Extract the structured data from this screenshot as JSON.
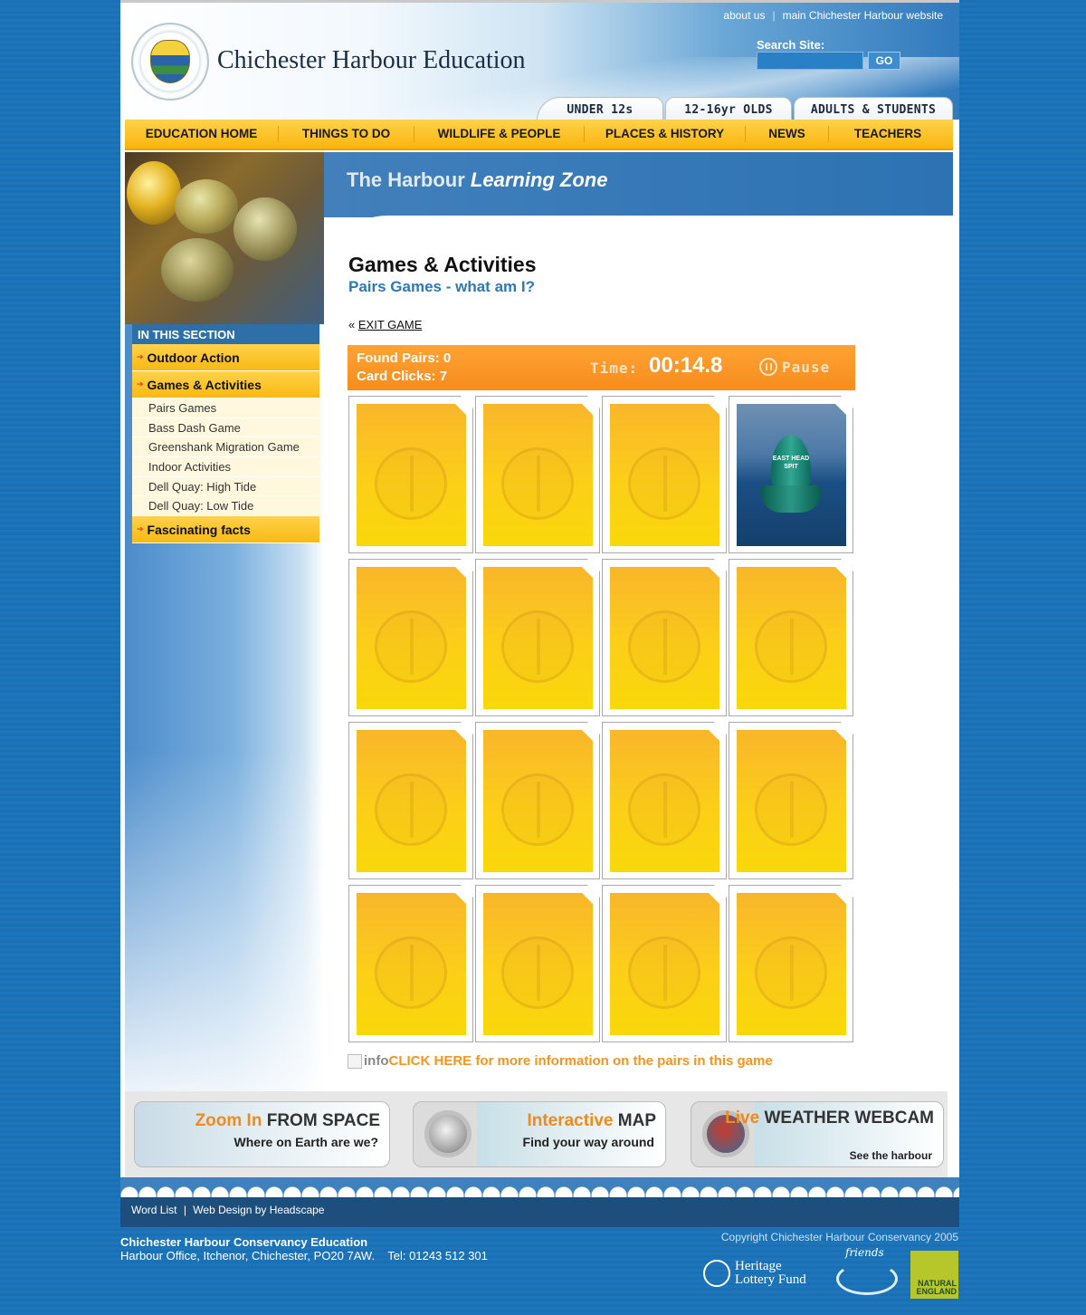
{
  "header": {
    "top_links": [
      "about us",
      "main Chichester Harbour website"
    ],
    "site_title": "Chichester Harbour Education",
    "search_label": "Search Site:",
    "search_value": "",
    "go_label": "GO",
    "audience_tabs": [
      "UNDER 12s",
      "12-16yr OLDS",
      "ADULTS & STUDENTS"
    ]
  },
  "main_nav": [
    "EDUCATION HOME",
    "THINGS TO DO",
    "WILDLIFE & PEOPLE",
    "PLACES & HISTORY",
    "NEWS",
    "TEACHERS"
  ],
  "banner": {
    "title_plain": "The Harbour",
    "title_italic": "Learning Zone"
  },
  "sidebar": {
    "heading": "IN THIS SECTION",
    "items": [
      {
        "label": "Outdoor Action"
      },
      {
        "label": "Games & Activities"
      }
    ],
    "subitems": [
      "Pairs Games",
      "Bass Dash Game",
      "Greenshank Migration Game",
      "Indoor Activities",
      "Dell Quay: High Tide",
      "Dell Quay: Low Tide"
    ],
    "last_item": "Fascinating facts"
  },
  "content": {
    "title": "Games & Activities",
    "subtitle": "Pairs Games - what am I?",
    "exit_prefix": "«",
    "exit_label": "EXIT GAME"
  },
  "game": {
    "found_pairs": "Found Pairs: 0",
    "card_clicks": "Card Clicks: 7",
    "time_label": "Time:",
    "time_value": "00:14.8",
    "pause_label": "Pause",
    "revealed_card_index": 3,
    "revealed_card_text": [
      "EAST HEAD",
      "SPIT"
    ],
    "card_count": 16
  },
  "info_link": {
    "alt_text": "info",
    "label": "CLICK HERE for more information on the pairs in this game"
  },
  "promos": [
    {
      "title_hl": "Zoom In",
      "title_rest": "FROM SPACE",
      "subtitle": "Where on Earth are we?"
    },
    {
      "title_hl": "Interactive",
      "title_rest": "MAP",
      "subtitle": "Find your way around"
    },
    {
      "title_hl": "Live",
      "title_rest": "WEATHER WEBCAM",
      "subtitle": "See the harbour"
    }
  ],
  "footer": {
    "links": [
      "Word List",
      "Web Design by Headscape"
    ],
    "separator": "|",
    "org": "Chichester Harbour Conservancy Education",
    "address": "Harbour Office, Itchenor, Chichester, PO20 7AW.    Tel: 01243 512 301",
    "copyright": "Copyright Chichester Harbour Conservancy 2005",
    "logos": {
      "hlf_line1": "Heritage",
      "hlf_line2": "Lottery Fund",
      "friends": "friends",
      "ne_line1": "NATURAL",
      "ne_line2": "ENGLAND"
    }
  },
  "colors": {
    "accent_orange": "#f68c1e",
    "nav_yellow": "#f9b50e",
    "link_blue": "#2d78b5",
    "background_blue": "#1a70b3"
  }
}
